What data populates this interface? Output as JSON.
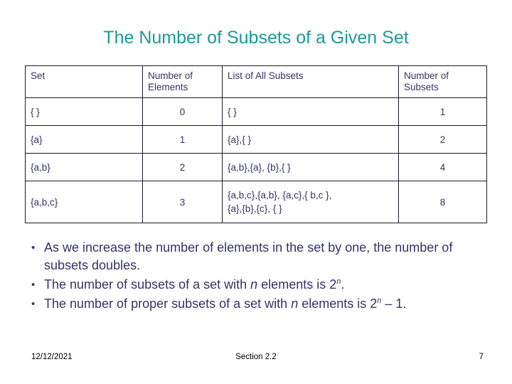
{
  "slide": {
    "title": "The Number of Subsets of a Given Set",
    "title_color": "#1a9a9a",
    "body_color": "#333366"
  },
  "table": {
    "headers": {
      "set": "Set",
      "number_of_elements": "Number of Elements",
      "list_of_all_subsets": "List of All Subsets",
      "number_of_subsets": "Number of Subsets"
    },
    "rows": [
      {
        "set": "{ }",
        "number_of_elements": "0",
        "list_of_all_subsets": "{ }",
        "number_of_subsets": "1"
      },
      {
        "set": "{a}",
        "number_of_elements": "1",
        "list_of_all_subsets": "{a},{ }",
        "number_of_subsets": "2"
      },
      {
        "set": "{a,b}",
        "number_of_elements": "2",
        "list_of_all_subsets": "{a,b},{a}, {b},{ }",
        "number_of_subsets": "4"
      },
      {
        "set": "{a,b,c}",
        "number_of_elements": "3",
        "list_of_all_subsets_line1": "{a,b,c},{a,b}, {a,c},{ b,c },",
        "list_of_all_subsets_line2": "{a},{b},{c}, { }",
        "number_of_subsets": "8"
      }
    ]
  },
  "bullets": {
    "item1": "As we increase the number of elements in the set by one, the number of subsets doubles.",
    "item2_part1": "The number of subsets of a set with ",
    "item2_var": "n",
    "item2_part2": " elements is 2",
    "item2_exp": "n",
    "item2_part3": ".",
    "item3_part1": "The number of proper subsets of a set with ",
    "item3_var": "n",
    "item3_part2": " elements is 2",
    "item3_exp": "n",
    "item3_part3": " – 1."
  },
  "footer": {
    "date": "12/12/2021",
    "section": "Section 2.2",
    "page": "7"
  }
}
